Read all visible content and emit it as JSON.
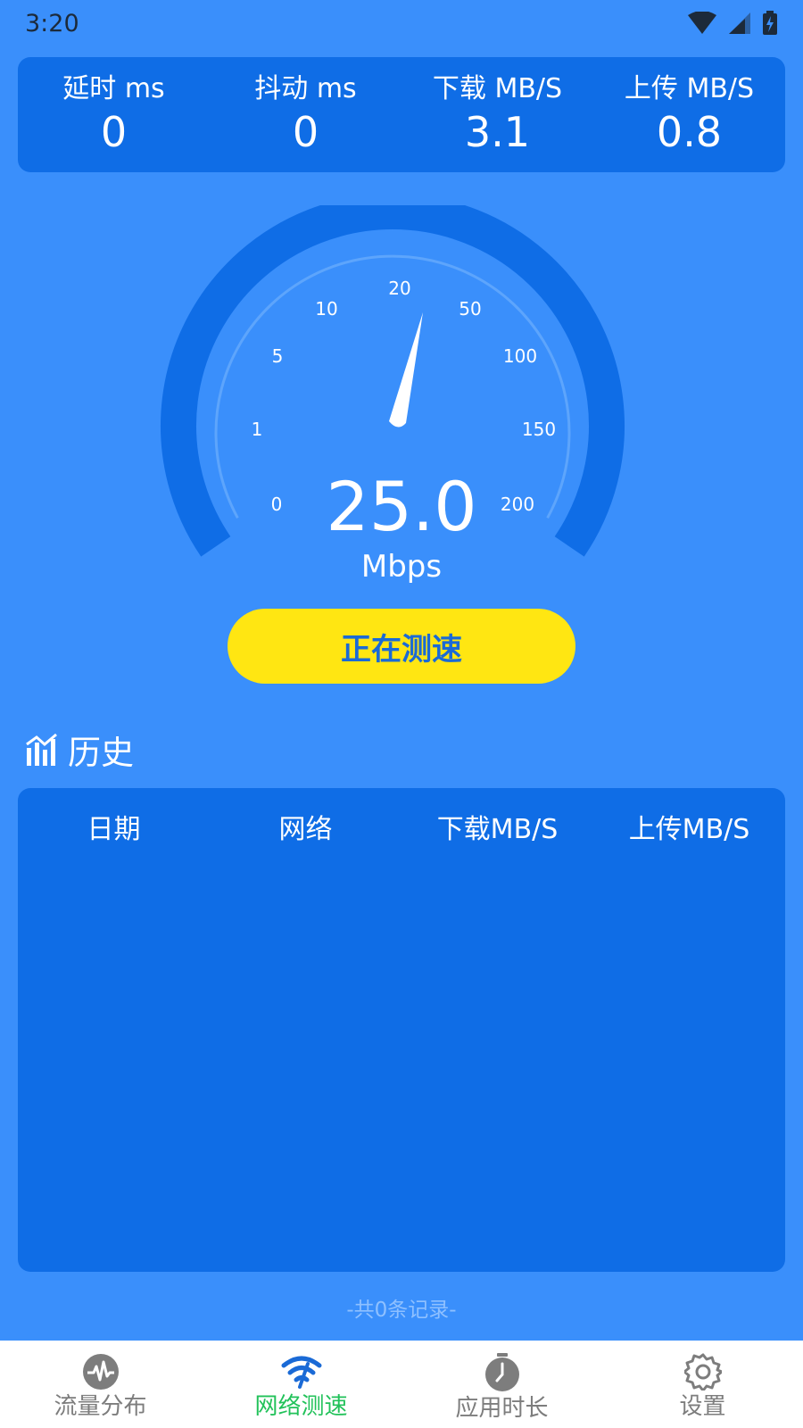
{
  "status_bar": {
    "time": "3:20"
  },
  "stats": [
    {
      "label": "延时 ms",
      "value": "0"
    },
    {
      "label": "抖动 ms",
      "value": "0"
    },
    {
      "label": "下载 MB/S",
      "value": "3.1"
    },
    {
      "label": "上传 MB/S",
      "value": "0.8"
    }
  ],
  "gauge": {
    "ticks": [
      "0",
      "1",
      "5",
      "10",
      "20",
      "50",
      "100",
      "150",
      "200"
    ],
    "value": "25.0",
    "unit": "Mbps"
  },
  "test_button": {
    "label": "正在测速"
  },
  "history": {
    "title": "历史",
    "columns": [
      "日期",
      "网络",
      "下载MB/S",
      "上传MB/S"
    ],
    "record_count": "-共0条记录-"
  },
  "bottom_nav": {
    "items": [
      {
        "label": "流量分布",
        "icon": "pulse-icon",
        "active": false
      },
      {
        "label": "网络测速",
        "icon": "wifi-speed-icon",
        "active": true
      },
      {
        "label": "应用时长",
        "icon": "stopwatch-icon",
        "active": false
      },
      {
        "label": "设置",
        "icon": "gear-icon",
        "active": false
      }
    ]
  },
  "colors": {
    "background": "#3a8ffb",
    "card": "#0f6de6",
    "button": "#ffe612",
    "button_text": "#1a6ad6",
    "nav_active": "#22c25a",
    "nav_inactive": "#7d7d7d"
  }
}
